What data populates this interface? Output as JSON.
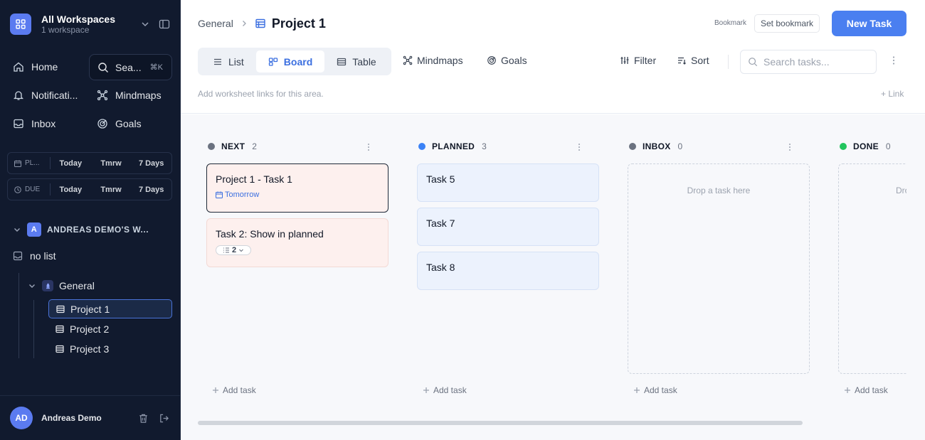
{
  "sidebar": {
    "workspace_title": "All Workspaces",
    "workspace_sub": "1 workspace",
    "nav": {
      "home": "Home",
      "search": "Sea...",
      "search_kbd": "⌘K",
      "notifications": "Notificati...",
      "mindmaps": "Mindmaps",
      "inbox": "Inbox",
      "goals": "Goals"
    },
    "planned_filter": {
      "label": "PL...",
      "today": "Today",
      "tomorrow": "Tmrw",
      "week": "7 Days"
    },
    "due_filter": {
      "label": "DUE",
      "today": "Today",
      "tomorrow": "Tmrw",
      "week": "7 Days"
    },
    "workspace_badge": "A",
    "workspace_name": "ANDREAS DEMO'S W...",
    "no_list": "no list",
    "folder": "General",
    "projects": [
      "Project 1",
      "Project 2",
      "Project 3"
    ],
    "user_initials": "AD",
    "user_name": "Andreas Demo"
  },
  "header": {
    "breadcrumb_parent": "General",
    "title": "Project 1",
    "bookmark_label": "Bookmark",
    "set_bookmark": "Set bookmark",
    "new_task": "New Task",
    "views": {
      "list": "List",
      "board": "Board",
      "table": "Table"
    },
    "mindmaps": "Mindmaps",
    "goals": "Goals",
    "filter": "Filter",
    "sort": "Sort",
    "search_placeholder": "Search tasks...",
    "links_hint": "Add worksheet links for this area.",
    "add_link": "+ Link"
  },
  "board": {
    "add_task": "Add task",
    "columns": [
      {
        "name": "NEXT",
        "count": "2",
        "color": "#6b7280",
        "cards": [
          {
            "title": "Project 1 - Task 1",
            "due": "Tomorrow"
          },
          {
            "title": "Task 2: Show in planned",
            "subtasks": "2"
          }
        ]
      },
      {
        "name": "PLANNED",
        "count": "3",
        "color": "#3b82f6",
        "cards": [
          {
            "title": "Task 5"
          },
          {
            "title": "Task 7"
          },
          {
            "title": "Task 8"
          }
        ]
      },
      {
        "name": "INBOX",
        "count": "0",
        "color": "#6b7280",
        "drop_text": "Drop a task here"
      },
      {
        "name": "DONE",
        "count": "0",
        "color": "#22c55e",
        "drop_text": "Dro"
      }
    ]
  },
  "colors": {
    "accent": "#4a7ff0",
    "sidebar_bg": "#111a2e"
  }
}
